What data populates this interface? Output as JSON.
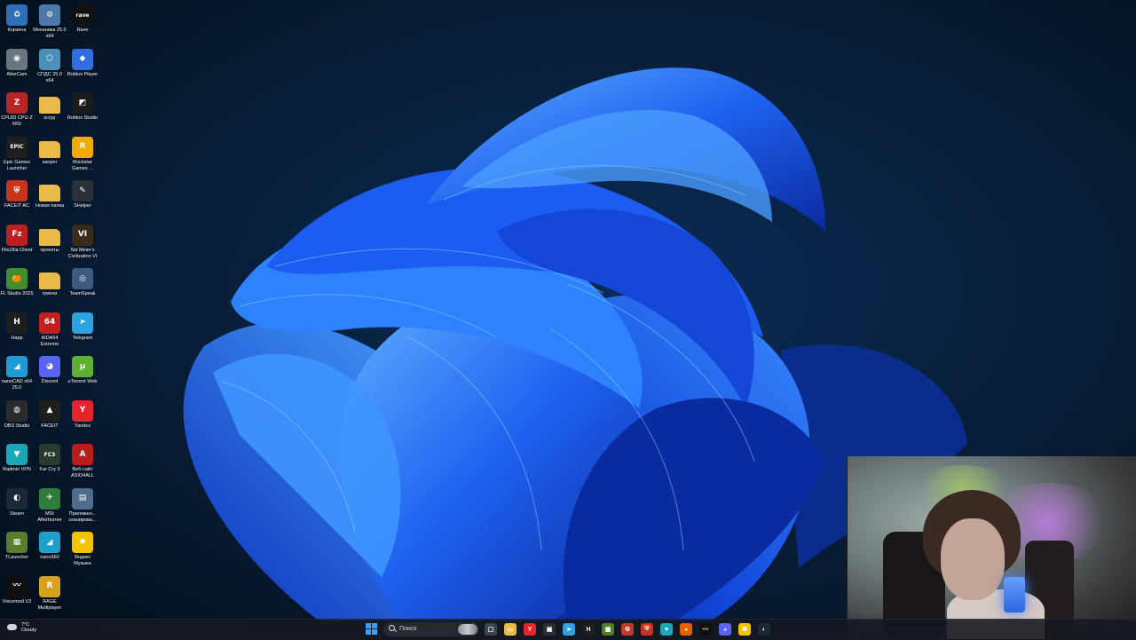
{
  "desktop": {
    "icons": [
      {
        "label": "Корзина",
        "icon": "recycle-bin-icon",
        "color": "#2d6fb8",
        "glyph": "♻"
      },
      {
        "label": "Механика 25.0 x64",
        "icon": "mechanics-app-icon",
        "color": "#4c79a8",
        "glyph": "⚙"
      },
      {
        "label": "Rave",
        "icon": "rave-icon",
        "color": "#111111",
        "glyph": "rave"
      },
      {
        "label": "AlterCam",
        "icon": "webcam-icon",
        "color": "#6c757d",
        "glyph": "◉"
      },
      {
        "label": "СПДС 25.0 x64",
        "icon": "spds-app-icon",
        "color": "#4c8fb8",
        "glyph": "⬡"
      },
      {
        "label": "Roblox Player",
        "icon": "roblox-player-icon",
        "color": "#2f6ee0",
        "glyph": "◆"
      },
      {
        "label": "CPUID CPU-Z MSI",
        "icon": "cpu-z-icon",
        "color": "#b82525",
        "glyph": "Z"
      },
      {
        "label": "scrpy",
        "icon": "folder-icon",
        "color": "#e9b949",
        "glyph": ""
      },
      {
        "label": "Roblox Studio",
        "icon": "roblox-studio-icon",
        "color": "#1b1b1b",
        "glyph": "◩"
      },
      {
        "label": "Epic Games Launcher",
        "icon": "epic-games-icon",
        "color": "#1e1e1e",
        "glyph": "EPIC"
      },
      {
        "label": "sanper",
        "icon": "folder-icon",
        "color": "#e9b949",
        "glyph": ""
      },
      {
        "label": "Rockstar Games ...",
        "icon": "rockstar-icon",
        "color": "#f2a900",
        "glyph": "R"
      },
      {
        "label": "FACEIT AC",
        "icon": "faceit-ac-icon",
        "color": "#c7361c",
        "glyph": "⛨"
      },
      {
        "label": "Новая папка",
        "icon": "folder-icon",
        "color": "#e9b949",
        "glyph": ""
      },
      {
        "label": "SHelper",
        "icon": "shelper-icon",
        "color": "#2a2f38",
        "glyph": "✎"
      },
      {
        "label": "FileZilla Client",
        "icon": "filezilla-icon",
        "color": "#bf1e1e",
        "glyph": "Fz"
      },
      {
        "label": "проекты",
        "icon": "folder-icon",
        "color": "#e9b949",
        "glyph": ""
      },
      {
        "label": "Sid Meier's Civilization VI",
        "icon": "civilization-icon",
        "color": "#3a2a1a",
        "glyph": "VI"
      },
      {
        "label": "FL Studio 2025",
        "icon": "fl-studio-icon",
        "color": "#3f8f2e",
        "glyph": "🍊"
      },
      {
        "label": "трекчи",
        "icon": "folder-icon",
        "color": "#e9b949",
        "glyph": ""
      },
      {
        "label": "TeamSpeak",
        "icon": "teamspeak-icon",
        "color": "#3d5a80",
        "glyph": "◎"
      },
      {
        "label": "Happ",
        "icon": "happ-icon",
        "color": "#1e1e1e",
        "glyph": "H"
      },
      {
        "label": "AIDA64 Extreme",
        "icon": "aida64-icon",
        "color": "#c41e1e",
        "glyph": "64"
      },
      {
        "label": "Telegram",
        "icon": "telegram-icon",
        "color": "#2aa3e0",
        "glyph": "➤"
      },
      {
        "label": "nanoCAD x64 25.0",
        "icon": "nanocad-icon",
        "color": "#1c9bd6",
        "glyph": "◢"
      },
      {
        "label": "Discord",
        "icon": "discord-icon",
        "color": "#5865f2",
        "glyph": "◕"
      },
      {
        "label": "uTorrent Web",
        "icon": "utorrent-icon",
        "color": "#5cb230",
        "glyph": "µ"
      },
      {
        "label": "OBS Studio",
        "icon": "obs-icon",
        "color": "#2b2b2b",
        "glyph": "◍"
      },
      {
        "label": "FACEIT",
        "icon": "faceit-icon",
        "color": "#1e1e1e",
        "glyph": "▲"
      },
      {
        "label": "Yandex",
        "icon": "yandex-icon",
        "color": "#e4262c",
        "glyph": "Y"
      },
      {
        "label": "Radmin VPN",
        "icon": "radmin-vpn-icon",
        "color": "#1aa7b8",
        "glyph": "▼"
      },
      {
        "label": "Far Cry 3",
        "icon": "far-cry-icon",
        "color": "#2b3b2b",
        "glyph": "FC3"
      },
      {
        "label": "Веб-сайт ASIO4ALL",
        "icon": "asio4all-icon",
        "color": "#b81e1e",
        "glyph": "A"
      },
      {
        "label": "Steam",
        "icon": "steam-icon",
        "color": "#1b2838",
        "glyph": "◐"
      },
      {
        "label": "MSI Afterburner",
        "icon": "msi-afterburner-icon",
        "color": "#2f7d3a",
        "glyph": "✈"
      },
      {
        "label": "Приложен... сканирова...",
        "icon": "scanner-app-icon",
        "color": "#4d6e8c",
        "glyph": "▤"
      },
      {
        "label": "TLauncher",
        "icon": "tlauncher-icon",
        "color": "#5a7d2c",
        "glyph": "▦"
      },
      {
        "label": "nano360",
        "icon": "nano360-icon",
        "color": "#1ea0c8",
        "glyph": "◢"
      },
      {
        "label": "Яндекс Музыка",
        "icon": "yandex-music-icon",
        "color": "#f5c200",
        "glyph": "✺"
      },
      {
        "label": "Voicemod V3",
        "icon": "voicemod-icon",
        "color": "#0f0f0f",
        "glyph": "〰"
      },
      {
        "label": "RAGE Multiplayer",
        "icon": "rage-mp-icon",
        "color": "#d6a21e",
        "glyph": "R"
      }
    ]
  },
  "taskbar": {
    "weather": {
      "temp": "7°C",
      "condition": "Cloudy"
    },
    "search_placeholder": "Поиск",
    "apps": [
      {
        "name": "task-view",
        "color": "#3d4450",
        "glyph": "▢"
      },
      {
        "name": "file-explorer",
        "color": "#e9b949",
        "glyph": "▭"
      },
      {
        "name": "yandex-browser",
        "color": "#e4262c",
        "glyph": "Y"
      },
      {
        "name": "cpu-app",
        "color": "#2a2f38",
        "glyph": "▣"
      },
      {
        "name": "telegram",
        "color": "#2aa3e0",
        "glyph": "➤"
      },
      {
        "name": "happ",
        "color": "#1e1e1e",
        "glyph": "H"
      },
      {
        "name": "minecraft",
        "color": "#4f7d2c",
        "glyph": "▦"
      },
      {
        "name": "settings",
        "color": "#c0392b",
        "glyph": "⚙"
      },
      {
        "name": "faceit-ac",
        "color": "#c7361c",
        "glyph": "⛨"
      },
      {
        "name": "radmin-vpn",
        "color": "#1aa7b8",
        "glyph": "▼"
      },
      {
        "name": "firefox",
        "color": "#e66000",
        "glyph": "◕"
      },
      {
        "name": "voicemod",
        "color": "#0f0f0f",
        "glyph": "〰"
      },
      {
        "name": "discord",
        "color": "#5865f2",
        "glyph": "◕"
      },
      {
        "name": "yandex-music",
        "color": "#f5c200",
        "glyph": "✺"
      },
      {
        "name": "steam",
        "color": "#1b2838",
        "glyph": "◐"
      }
    ]
  }
}
